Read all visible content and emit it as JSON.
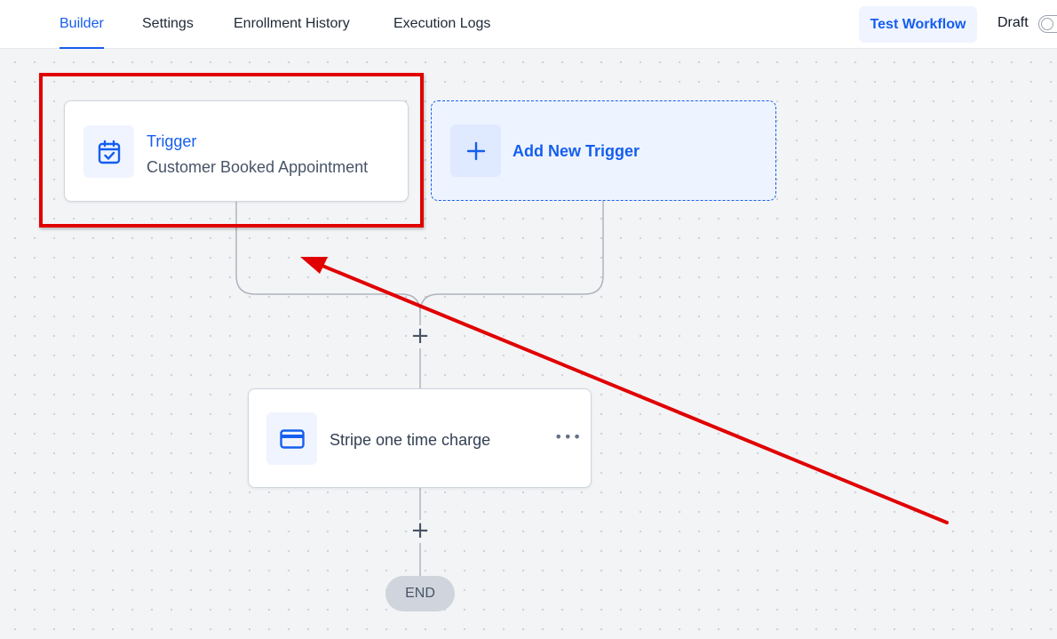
{
  "tabs": [
    {
      "label": "Builder",
      "active": true
    },
    {
      "label": "Settings",
      "active": false
    },
    {
      "label": "Enrollment History",
      "active": false
    },
    {
      "label": "Execution Logs",
      "active": false
    }
  ],
  "header": {
    "test_workflow_label": "Test Workflow",
    "status_label": "Draft"
  },
  "trigger": {
    "title": "Trigger",
    "subtitle": "Customer Booked Appointment",
    "icon": "calendar-check-icon"
  },
  "add_trigger": {
    "label": "Add New Trigger",
    "icon": "plus-icon"
  },
  "add_step_symbol": "+",
  "action": {
    "label": "Stripe one time charge",
    "icon": "credit-card-icon",
    "menu_symbol": "•••"
  },
  "end_label": "END",
  "colors": {
    "accent": "#155eef",
    "annotation_red": "#e00000",
    "canvas_bg": "#f3f4f6"
  }
}
